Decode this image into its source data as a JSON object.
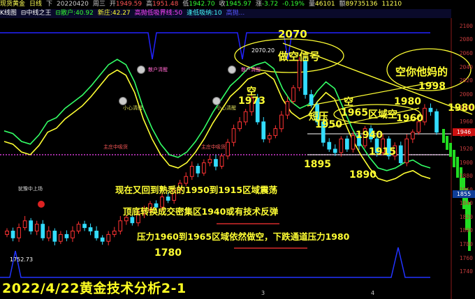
{
  "header": {
    "symbol": "现货黄金",
    "period": "日线",
    "dir": "下",
    "date": "20220420",
    "weekday": "周三",
    "open_label": "开",
    "open": "1949.59",
    "high_label": "高",
    "high": "1951.48",
    "low_label": "低",
    "low": "1942.70",
    "close_label": "收",
    "close": "1945.97",
    "change_label": "涨",
    "change": "-3.72",
    "change_pct": "-0.19%",
    "volume_label": "量",
    "volume": "46101",
    "amount_label": "额",
    "amount": "89735136",
    "extra": "11210"
  },
  "indicator_bar": {
    "name": "K线图",
    "line1": "中线之王",
    "line2_label": "散户:",
    "line2_value": "40.92",
    "line3_label": "新庄:",
    "line3_value": "42.27",
    "line4": "高抛低吸界线:50",
    "line5": "逢低吸纳:10",
    "line6": "高抛...",
    "colors": {
      "name": "#ffffff",
      "line1": "#ffffff",
      "line2": "#33ff33",
      "line3": "#ffff33",
      "line4": "#ff44ff",
      "line5": "#44ffff",
      "line6": "#5555ff"
    }
  },
  "price_axis": {
    "ticks": [
      "2100",
      "2080",
      "2060",
      "2040",
      "2020",
      "2000",
      "1980",
      "1960",
      "1940",
      "1920",
      "1900",
      "1880",
      "1860",
      "1840",
      "1820",
      "1800",
      "1780",
      "1760",
      "1740"
    ],
    "current": "1855",
    "current_flag": "1946"
  },
  "chart_labels": {
    "p2070": "2070",
    "p2070_small": "2070.20",
    "p1973": "1973",
    "kong1": "空",
    "kong2": "空",
    "p1965": "1965",
    "p1960": "1960",
    "p1950": "1950",
    "p1940": "1940",
    "p1915": "1915",
    "p1895": "1895",
    "p1890": "1890",
    "p1980a": "1980",
    "p1980b": "1980",
    "p1998": "1998",
    "p1780": "1780",
    "p1752": "1752.73",
    "zuokong": "做空信号",
    "kongni": "空你他妈的",
    "duanya": "短压",
    "quyukong": "区域空",
    "xiaoxin1": "小心清醒",
    "xiaoxin2": "小心清醒",
    "zhuangjia1": "主庄中吸货",
    "zhuangjia2": "主庄中吸货",
    "youyu": "犹豫中上场",
    "x_tick_3": "3",
    "x_tick_4": "4",
    "small_top1": "散户清醒",
    "small_top2": "散户清醒"
  },
  "annotations": {
    "line1": "现在又回到熟悉的1950到1915区域震荡",
    "line2": "顶底转换成交密集区1940或有技术反弹",
    "line3": "压力1960到1965区域依然做空，下跌通道压力1980"
  },
  "footer": {
    "title": "2022/4/22黄金技术分析2-1"
  },
  "chart_data": {
    "type": "candlestick",
    "instrument": "现货黄金",
    "period": "日线",
    "ylim": [
      1730,
      2110
    ],
    "key_levels": {
      "2070": 2070,
      "1998": 1998,
      "1980": 1980,
      "1973": 1973,
      "1965": 1965,
      "1960": 1960,
      "1950": 1950,
      "1940": 1940,
      "1915": 1915,
      "1895": 1895,
      "1890": 1890,
      "1780": 1780,
      "1752.73": 1752.73
    },
    "closes": [
      1800,
      1790,
      1805,
      1815,
      1800,
      1810,
      1790,
      1800,
      1785,
      1795,
      1790,
      1800,
      1810,
      1805,
      1800,
      1790,
      1785,
      1795,
      1800,
      1815,
      1820,
      1812,
      1825,
      1830,
      1840,
      1835,
      1850,
      1845,
      1860,
      1870,
      1880,
      1895,
      1885,
      1900,
      1905,
      1895,
      1910,
      1930,
      1950,
      1960,
      1975,
      1995,
      1960,
      1935,
      1940,
      1950,
      1970,
      1990,
      2010,
      2050,
      2000,
      1985,
      1960,
      1930,
      1920,
      1915,
      1935,
      1920,
      1940,
      1925,
      1950,
      1935,
      1915,
      1935,
      1910,
      1925,
      1900,
      1935,
      1945,
      1960,
      1980,
      1975,
      1945
    ],
    "oscillator": {
      "name": "中线之王",
      "values": [
        38,
        36,
        30,
        28,
        35,
        45,
        48,
        55,
        60,
        65,
        72,
        80,
        88,
        92,
        88,
        75,
        55,
        40,
        28,
        20,
        18,
        22,
        30,
        40,
        52,
        62,
        72,
        78,
        85,
        88,
        90,
        85,
        70,
        60,
        55,
        58,
        68,
        75,
        70,
        55,
        40,
        28,
        18,
        10,
        8,
        10,
        14,
        16,
        12,
        10
      ]
    }
  }
}
